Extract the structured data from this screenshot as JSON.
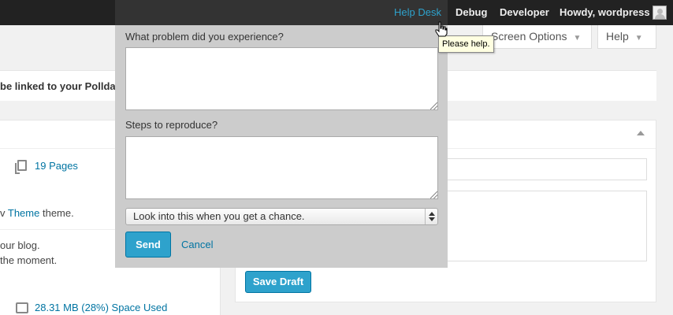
{
  "adminbar": {
    "help_desk": "Help Desk",
    "debug": "Debug",
    "developer": "Developer",
    "howdy": "Howdy, wordpress"
  },
  "screen_meta": {
    "screen_options": "Screen Options",
    "help": "Help"
  },
  "background": {
    "notice_text": "be linked to your Polldad",
    "pages_count": "19 Pages",
    "theme_prefix": "v ",
    "theme_link": "Theme",
    "theme_suffix": " theme.",
    "blog_line": "our blog.",
    "moment_line": " the moment.",
    "space_used": "28.31 MB (28%) Space Used",
    "save_draft": "Save Draft"
  },
  "helpdesk_form": {
    "problem_label": "What problem did you experience?",
    "problem_value": "",
    "steps_label": "Steps to reproduce?",
    "steps_value": "",
    "priority_selected": "Look into this when you get a chance.",
    "send_label": "Send",
    "cancel_label": "Cancel"
  },
  "tooltip": {
    "text": "Please help."
  },
  "colors": {
    "accent": "#2ea2cc",
    "link": "#0074a2",
    "adminbar_bg": "#222222",
    "panel_bg": "#cccccc"
  }
}
